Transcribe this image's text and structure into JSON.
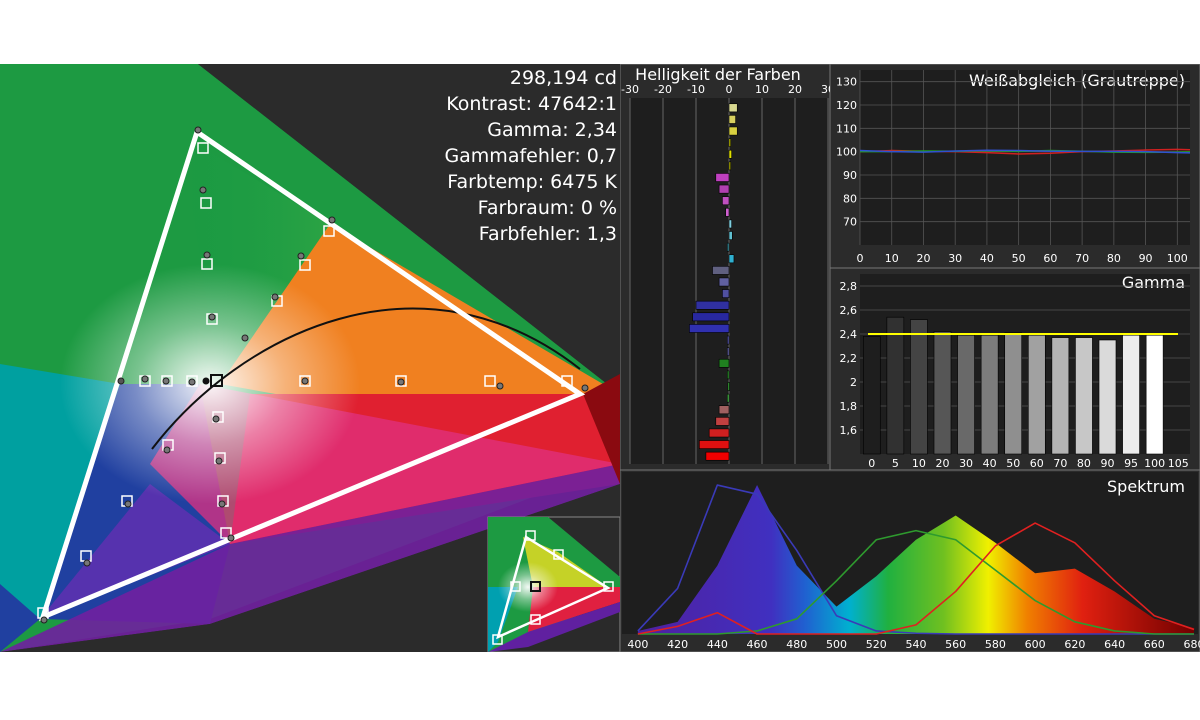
{
  "stats": {
    "luminance": "298,194 cd",
    "contrast": "Kontrast: 47642:1",
    "gamma": "Gamma: 2,34",
    "gamma_error": "Gammafehler: 0,7",
    "color_temp": "Farbtemp: 6475 K",
    "color_space": "Farbraum: 0 %",
    "color_error": "Farbfehler: 1,3"
  },
  "colors": {
    "background": "#2b2b2b",
    "panel": "#1e1e1e",
    "gamma_target": "#ffff00",
    "spectrum_blue": "#3a3ab8",
    "spectrum_green": "#2e9a2e",
    "spectrum_red": "#e02020"
  },
  "chart_data": [
    {
      "type": "scatter",
      "name": "cie-gamut",
      "targets": [
        {
          "x": 0.64,
          "y": 0.33
        },
        {
          "x": 0.3,
          "y": 0.6
        },
        {
          "x": 0.15,
          "y": 0.06
        },
        {
          "x": 0.225,
          "y": 0.329
        },
        {
          "x": 0.3127,
          "y": 0.329
        },
        {
          "x": 0.419,
          "y": 0.505
        }
      ],
      "measured": [
        {
          "x": 0.643,
          "y": 0.331
        },
        {
          "x": 0.299,
          "y": 0.605
        },
        {
          "x": 0.15,
          "y": 0.058
        },
        {
          "x": 0.224,
          "y": 0.331
        },
        {
          "x": 0.311,
          "y": 0.331
        },
        {
          "x": 0.42,
          "y": 0.508
        }
      ]
    },
    {
      "type": "bar",
      "name": "helligkeit-der-farben",
      "title": "Helligkeit der Farben",
      "xticks": [
        "-30",
        "-20",
        "-10",
        "0",
        "10",
        "20",
        "30"
      ],
      "xlim": [
        -30,
        30
      ],
      "values": [
        2.5,
        2,
        2.5,
        0.5,
        0.8,
        0.5,
        -4,
        -3,
        -2,
        -1,
        0.8,
        1,
        -0.5,
        1.5,
        -5,
        -3,
        -2,
        -10,
        -11,
        -12,
        -0.5,
        -0.5,
        -3,
        -0.5,
        -0.3,
        -0.5,
        -3,
        -4,
        -6,
        -9,
        -7
      ],
      "bar_colors": [
        "#d8d890",
        "#d8d060",
        "#d8d040",
        "#d0d000",
        "#e0e000",
        "#c0c000",
        "#c040c0",
        "#b040b0",
        "#c050c0",
        "#d060d0",
        "#80d0e0",
        "#60c0d0",
        "#40a0b0",
        "#30b0d0",
        "#606080",
        "#6060a0",
        "#5050a0",
        "#3030a0",
        "#2828a0",
        "#3030b0",
        "#6060c0",
        "#7070c0",
        "#208020",
        "#30a030",
        "#40c040",
        "#50d050",
        "#a06060",
        "#c04040",
        "#d02020",
        "#e01010",
        "#f00000"
      ]
    },
    {
      "type": "line",
      "name": "weissabgleich",
      "title": "Weißabgleich (Grautreppe)",
      "x": [
        0,
        10,
        20,
        30,
        40,
        50,
        60,
        70,
        80,
        90,
        100,
        104
      ],
      "xlim": [
        0,
        104
      ],
      "ylim": [
        60,
        135
      ],
      "yticks": [
        70,
        80,
        90,
        100,
        110,
        120,
        130
      ],
      "xticks": [
        0,
        10,
        20,
        30,
        40,
        50,
        60,
        70,
        80,
        90,
        100
      ],
      "series": [
        {
          "color": "#d02020",
          "values": [
            100,
            100.5,
            100.2,
            100,
            99.6,
            99,
            99.3,
            100,
            100.3,
            100.7,
            101,
            100.8
          ]
        },
        {
          "color": "#20a020",
          "values": [
            100,
            100,
            100.3,
            100.2,
            100.4,
            100.1,
            100.5,
            100.2,
            99.8,
            99.7,
            99.8,
            99.9
          ]
        },
        {
          "color": "#3050d0",
          "values": [
            100.5,
            100,
            99.8,
            100.3,
            100.6,
            100.5,
            100.2,
            100.1,
            100.1,
            100,
            99.6,
            99.5
          ]
        }
      ]
    },
    {
      "type": "bar",
      "name": "gamma",
      "title": "Gamma",
      "categories": [
        "0",
        "5",
        "10",
        "20",
        "30",
        "40",
        "50",
        "60",
        "70",
        "80",
        "90",
        "95",
        "100",
        "105"
      ],
      "values": [
        2.38,
        2.54,
        2.52,
        2.42,
        2.39,
        2.39,
        2.41,
        2.39,
        2.37,
        2.37,
        2.35,
        2.39,
        2.39
      ],
      "target": 2.4,
      "ylim": [
        1.4,
        2.9
      ],
      "yticks": [
        "1,6",
        "1,8",
        "2",
        "2,2",
        "2,4",
        "2,6",
        "2,8"
      ]
    },
    {
      "type": "area",
      "name": "spektrum",
      "title": "Spektrum",
      "x": [
        400,
        420,
        440,
        460,
        480,
        500,
        520,
        540,
        560,
        580,
        600,
        620,
        640,
        660,
        680
      ],
      "xlim": [
        392,
        682
      ],
      "measured": [
        0.02,
        0.08,
        0.45,
        0.98,
        0.45,
        0.18,
        0.38,
        0.62,
        0.78,
        0.6,
        0.4,
        0.43,
        0.28,
        0.1,
        0.04
      ],
      "curves": [
        {
          "color": "#3a3ab8",
          "values": [
            0.02,
            0.3,
            0.98,
            0.92,
            0.55,
            0.12,
            0.02,
            0.005,
            0,
            0,
            0,
            0,
            0,
            0,
            0
          ]
        },
        {
          "color": "#2e9a2e",
          "values": [
            0,
            0,
            0,
            0.02,
            0.1,
            0.35,
            0.62,
            0.68,
            0.62,
            0.42,
            0.22,
            0.08,
            0.02,
            0,
            0
          ]
        },
        {
          "color": "#e02020",
          "values": [
            0,
            0.05,
            0.14,
            0,
            0,
            0,
            0,
            0.06,
            0.28,
            0.58,
            0.73,
            0.6,
            0.35,
            0.12,
            0.03
          ]
        }
      ]
    }
  ]
}
